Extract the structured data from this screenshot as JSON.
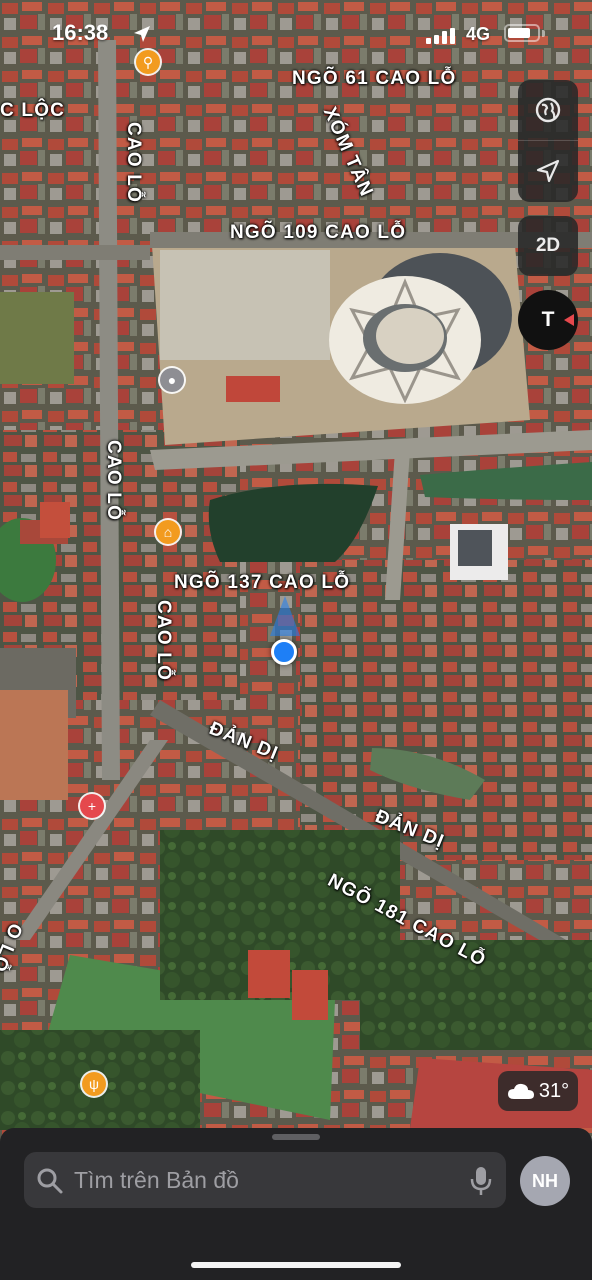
{
  "status_bar": {
    "time": "16:38",
    "network": "4G",
    "battery_level": 0.8
  },
  "map": {
    "street_labels": [
      {
        "text": "NGÕ 61 CAO LỖ",
        "id": "ngo-61-cao-lo"
      },
      {
        "text": "C LỘC",
        "id": "c-loc"
      },
      {
        "text": "XÓM TÂN",
        "id": "xom-tan"
      },
      {
        "text": "CAO LỖ",
        "id": "cao-lo-1"
      },
      {
        "text": "NGÕ 109 CAO LỖ",
        "id": "ngo-109-cao-lo"
      },
      {
        "text": "CAO LỖ",
        "id": "cao-lo-2"
      },
      {
        "text": "NGÕ 137 CAO LỖ",
        "id": "ngo-137-cao-lo"
      },
      {
        "text": "CAO LỖ",
        "id": "cao-lo-3"
      },
      {
        "text": "ĐẢN DỊ",
        "id": "dan-di-1"
      },
      {
        "text": "ĐẢN DỊ",
        "id": "dan-di-2"
      },
      {
        "text": "NGÕ 181 CAO LỖ",
        "id": "ngo-181-cao-lo"
      },
      {
        "text": "O LỖ",
        "id": "o-lo"
      }
    ]
  },
  "controls": {
    "view_mode_label": "2D",
    "compass_label": "T"
  },
  "weather": {
    "temperature": "31°"
  },
  "search": {
    "placeholder": "Tìm trên Bản đồ"
  },
  "profile": {
    "initials": "NH"
  },
  "colors": {
    "accent_blue": "#1e7ff6",
    "poi_orange": "#f29b1f",
    "poi_red": "#e5484d",
    "poi_gray": "#8e8e93"
  }
}
